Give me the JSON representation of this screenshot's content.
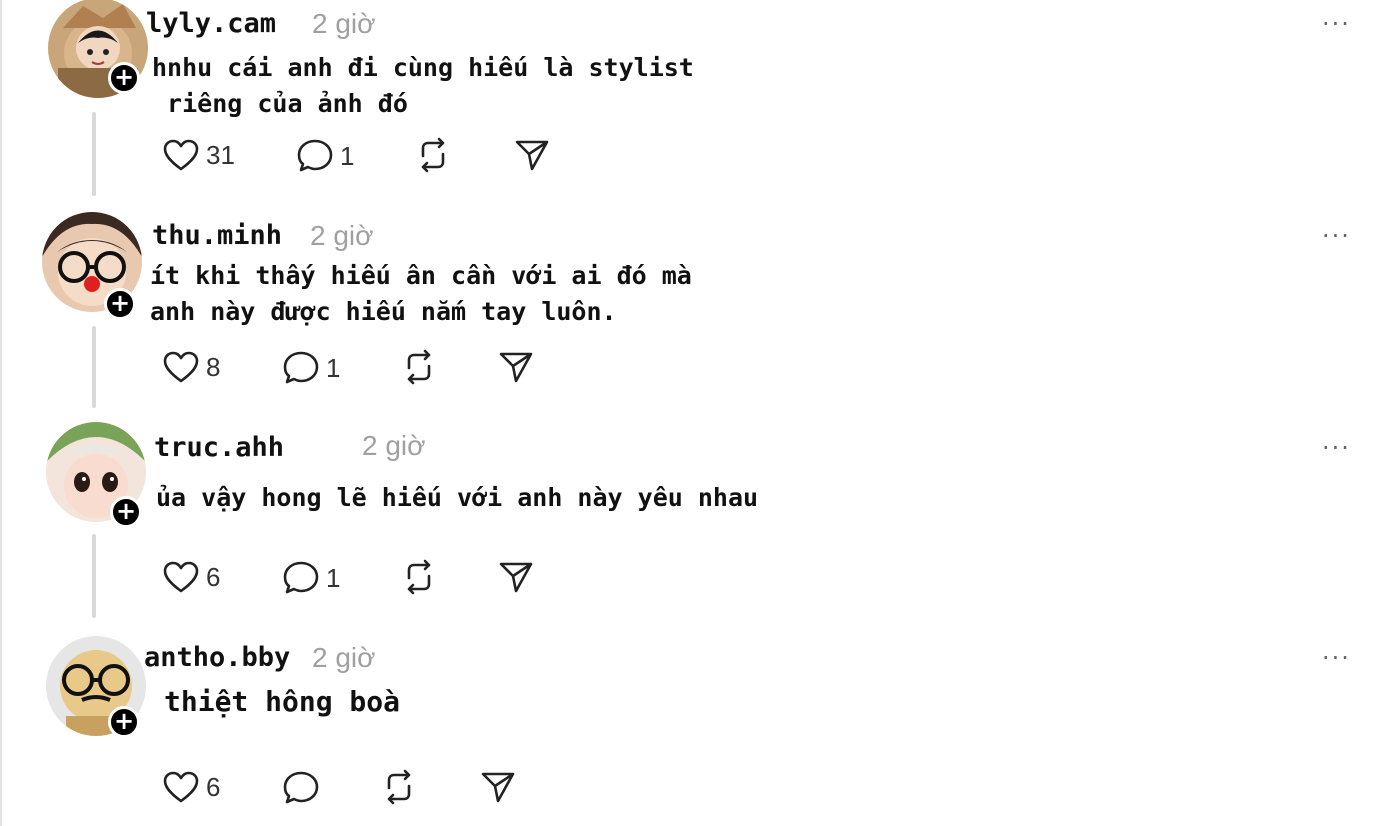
{
  "posts": [
    {
      "username": "lyly.cam",
      "time": "2 giờ",
      "lines": [
        "hnhu cái anh đi cùng hiếu là stylist",
        " riêng của ảnh đó"
      ],
      "likes": "31",
      "replies": "1"
    },
    {
      "username": "thu.minh",
      "time": "2 giờ",
      "lines": [
        "ít khi thấy hiếu ân cần với ai đó mà",
        "anh này được hiếu nắm tay luôn."
      ],
      "likes": "8",
      "replies": "1"
    },
    {
      "username": "truc.ahh",
      "time": "2 giờ",
      "lines": [
        "ủa vậy hong lẽ hiếu với anh này yêu nhau"
      ],
      "likes": "6",
      "replies": "1"
    },
    {
      "username": "antho.bby",
      "time": "2 giờ",
      "lines": [
        "thiệt hông boà"
      ],
      "likes": "6",
      "replies": ""
    }
  ],
  "more_label": "···",
  "follow_label": "+",
  "icons": {
    "like": "heart-icon",
    "reply": "comment-icon",
    "repost": "repost-icon",
    "share": "send-icon",
    "more": "more-icon",
    "follow": "plus-icon"
  },
  "colors": {
    "text": "#111111",
    "muted": "#a0a0a0",
    "thread_line": "#d9d9d9",
    "follow_badge": "#000000"
  }
}
